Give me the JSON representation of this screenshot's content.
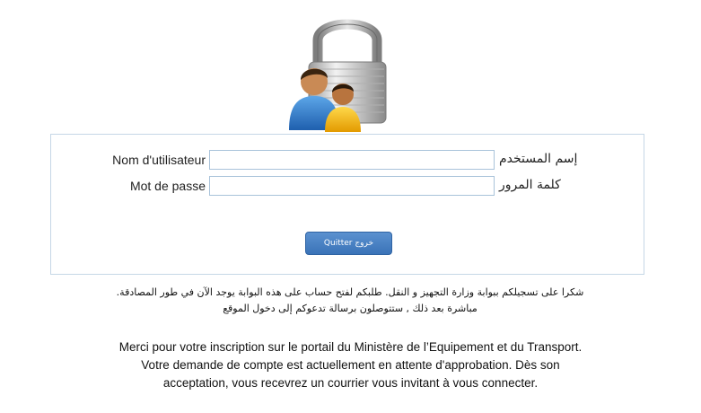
{
  "login": {
    "username_label_fr": "Nom d'utilisateur",
    "username_label_ar": "إسم المستخدم",
    "username_value": "",
    "password_label_fr": "Mot de passe",
    "password_label_ar": "كلمة المرور",
    "password_value": "",
    "quit_button": "Quitter  خروج"
  },
  "message_ar": {
    "line1": "شكرا على تسجيلكم ببوابة وزارة التجهيز و النقل. طلبكم لفتح حساب على هذه البوابة يوجد الآن في طور المصادقة.",
    "line2": "مباشرة بعد ذلك , ستتوصلون برسالة تدعوكم إلى دخول الموقع"
  },
  "message_fr": {
    "line1": "Merci pour votre inscription sur le portail du Ministère de l’Equipement et du Transport.",
    "line2": "Votre demande de compte est actuellement en attente d'approbation. Dès son",
    "line3": "acceptation, vous recevrez un courrier vous invitant à vous connecter."
  },
  "colors": {
    "button_bg": "#4a82c4",
    "box_border": "#c5d7e6"
  },
  "icons": {
    "logo": "padlock-users-icon"
  }
}
